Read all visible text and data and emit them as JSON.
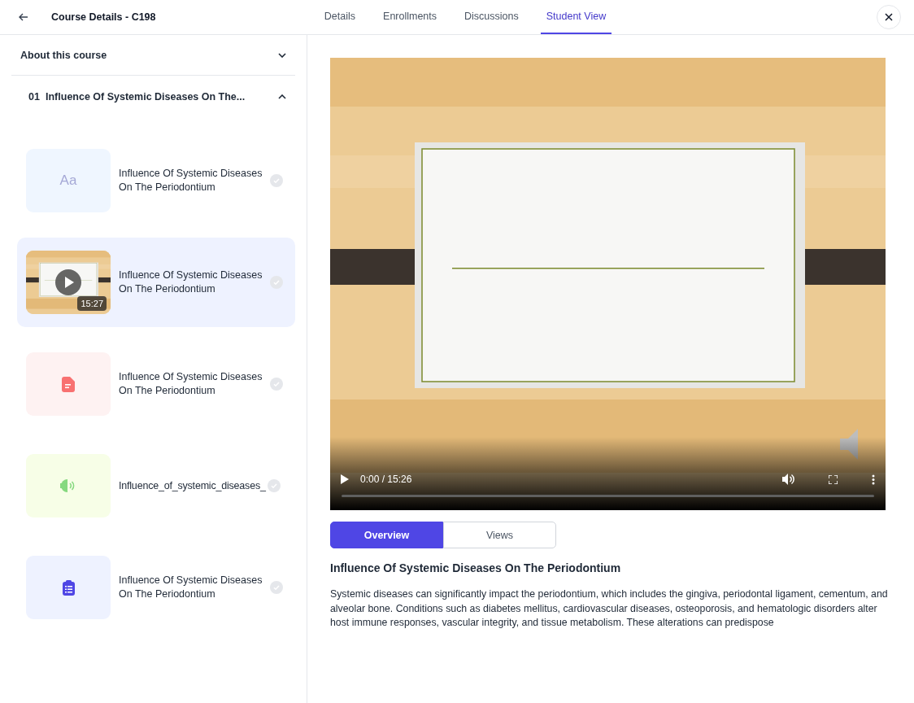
{
  "header": {
    "title": "Course Details - C198",
    "tabs": [
      {
        "label": "Details",
        "selected": false
      },
      {
        "label": "Enrollments",
        "selected": false
      },
      {
        "label": "Discussions",
        "selected": false
      },
      {
        "label": "Student View",
        "selected": true
      }
    ]
  },
  "sidebar": {
    "about": {
      "label": "About this course",
      "expanded": false
    },
    "section": {
      "number": "01",
      "title": "Influence Of Systemic Diseases On The...",
      "expanded": true
    },
    "lessons": [
      {
        "kind": "text",
        "icon_text": "Aa",
        "title": "Influence Of Systemic Diseases On The Periodontium",
        "selected": false,
        "completed": false
      },
      {
        "kind": "video",
        "duration": "15:27",
        "title": "Influence Of Systemic Diseases On The Periodontium",
        "selected": true,
        "completed": false
      },
      {
        "kind": "document",
        "title": "Influence Of Systemic Diseases On The Periodontium",
        "selected": false,
        "completed": false
      },
      {
        "kind": "audio",
        "title": "Influence_of_systemic_diseases_",
        "selected": false,
        "completed": false
      },
      {
        "kind": "quiz",
        "title": "Influence Of Systemic Diseases On The Periodontium",
        "selected": false,
        "completed": false
      }
    ]
  },
  "player": {
    "time": "0:00 / 15:26"
  },
  "content_tabs": [
    {
      "label": "Overview",
      "selected": true
    },
    {
      "label": "Views",
      "selected": false
    }
  ],
  "lesson_title": "Influence Of Systemic Diseases On The Periodontium",
  "description": "Systemic diseases can significantly impact the periodontium, which includes the gingiva, periodontal ligament, cementum, and alveolar bone. Conditions such as diabetes mellitus, cardiovascular diseases, osteoporosis, and hematologic disorders alter host immune responses, vascular integrity, and tissue metabolism. These alterations can predispose"
}
